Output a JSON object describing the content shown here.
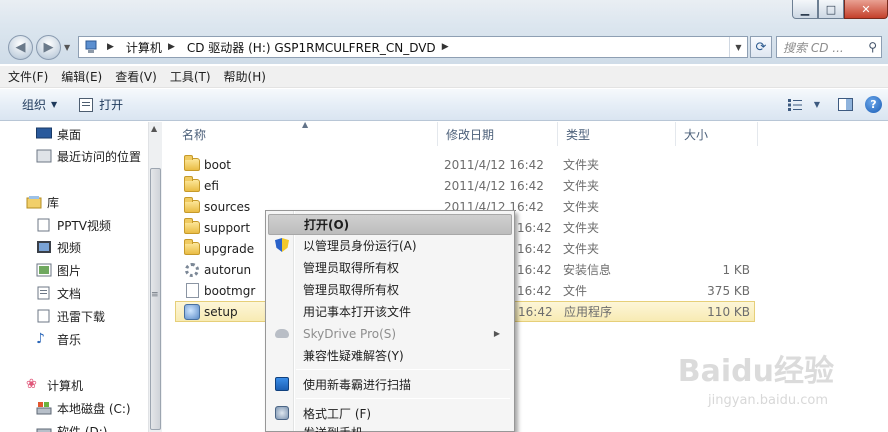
{
  "window": {
    "controls": {
      "minimize": "▁",
      "maximize": "□",
      "close": "✕"
    }
  },
  "address": {
    "crumbs": [
      "计算机",
      "CD 驱动器 (H:) GSP1RMCULFRER_CN_DVD"
    ],
    "search_placeholder": "搜索 CD ..."
  },
  "menubar": [
    "文件(F)",
    "编辑(E)",
    "查看(V)",
    "工具(T)",
    "帮助(H)"
  ],
  "commandbar": {
    "organize": "组织",
    "open": "打开"
  },
  "navpane": {
    "favorites": [
      "桌面",
      "最近访问的位置"
    ],
    "libraries_head": "库",
    "libraries": [
      "PPTV视频",
      "视频",
      "图片",
      "文档",
      "迅雷下载",
      "音乐"
    ],
    "computer_head": "计算机",
    "drives": [
      "本地磁盘 (C:)",
      "软件 (D:)"
    ]
  },
  "columns": {
    "name": "名称",
    "date": "修改日期",
    "type": "类型",
    "size": "大小"
  },
  "files": [
    {
      "name": "boot",
      "date": "2011/4/12 16:42",
      "type": "文件夹",
      "size": "",
      "icon": "folder-icon"
    },
    {
      "name": "efi",
      "date": "2011/4/12 16:42",
      "type": "文件夹",
      "size": "",
      "icon": "folder-icon"
    },
    {
      "name": "sources",
      "date": "2011/4/12 16:42",
      "type": "文件夹",
      "size": "",
      "icon": "folder-icon"
    },
    {
      "name": "support",
      "date": "16:42",
      "type": "文件夹",
      "size": "",
      "icon": "folder-icon"
    },
    {
      "name": "upgrade",
      "date": "16:42",
      "type": "文件夹",
      "size": "",
      "icon": "folder-icon"
    },
    {
      "name": "autorun",
      "date": "16:42",
      "type": "安装信息",
      "size": "1 KB",
      "icon": "settings-file-icon"
    },
    {
      "name": "bootmgr",
      "date": "16:42",
      "type": "文件",
      "size": "375 KB",
      "icon": "file-icon"
    },
    {
      "name": "setup",
      "date": "16:42",
      "type": "应用程序",
      "size": "110 KB",
      "icon": "application-icon"
    }
  ],
  "context_menu": {
    "items": [
      {
        "label": "打开(O)",
        "icon": ""
      },
      {
        "label": "以管理员身份运行(A)",
        "icon": "uac-shield-icon"
      },
      {
        "label": "管理员取得所有权",
        "icon": ""
      },
      {
        "label": "管理员取得所有权",
        "icon": ""
      },
      {
        "label": "用记事本打开该文件",
        "icon": ""
      },
      {
        "label": "SkyDrive Pro(S)",
        "icon": "cloud-icon"
      },
      {
        "label": "兼容性疑难解答(Y)",
        "icon": ""
      },
      {
        "label": "使用新毒霸进行扫描",
        "icon": "antivirus-scan-icon"
      },
      {
        "label": "格式工厂 (F)",
        "icon": "format-factory-icon"
      },
      {
        "label": "发送到手机",
        "icon": ""
      }
    ]
  },
  "watermark": {
    "brand": "Baidu经验",
    "url": "jingyan.baidu.com"
  },
  "colors": {
    "selection": "#f8ebb3",
    "menu_highlight": "#bdbdbd",
    "command_text": "#1e395b"
  }
}
